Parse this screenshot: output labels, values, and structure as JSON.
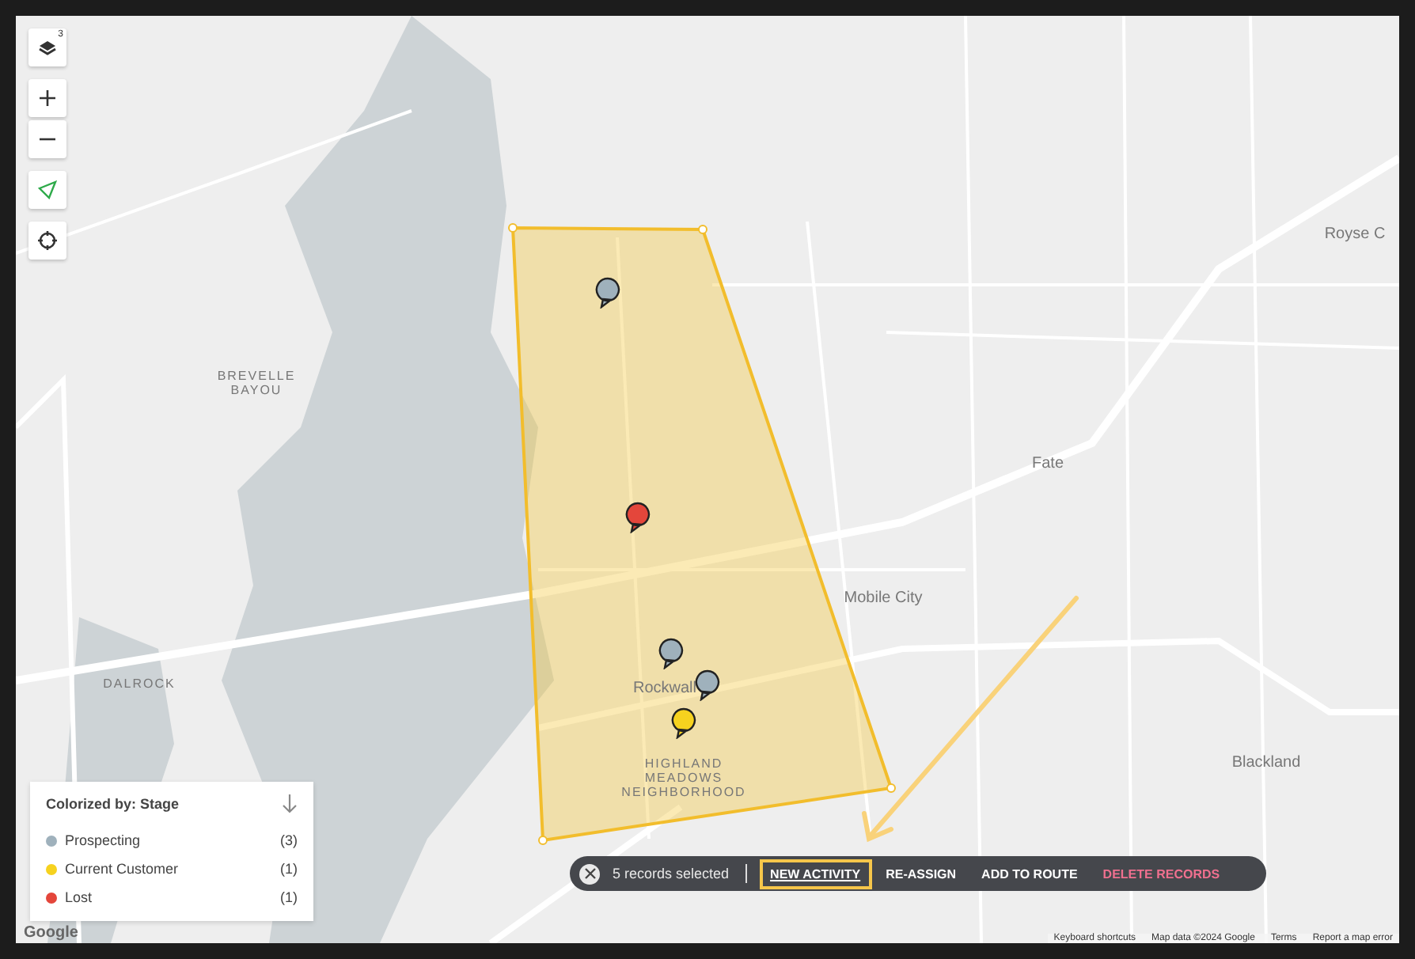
{
  "map_controls": {
    "layers_badge": "3"
  },
  "places": [
    {
      "label": "BREVELLE\nBAYOU",
      "kind": "area"
    },
    {
      "label": "DALROCK",
      "kind": "area"
    },
    {
      "label": "Mobile City",
      "kind": "city"
    },
    {
      "label": "Fate",
      "kind": "city"
    },
    {
      "label": "Blackland",
      "kind": "city"
    },
    {
      "label": "Rockwall",
      "kind": "city"
    },
    {
      "label": "HIGHLAND\nMEADOWS\nNEIGHBORHOOD",
      "kind": "area"
    },
    {
      "label": "Royse C",
      "kind": "city"
    }
  ],
  "pins": [
    {
      "color": "#9fb1bc"
    },
    {
      "color": "#e4463b"
    },
    {
      "color": "#9fb1bc"
    },
    {
      "color": "#9fb1bc"
    },
    {
      "color": "#f6d21f"
    }
  ],
  "legend": {
    "title": "Colorized by: Stage",
    "items": [
      {
        "label": "Prospecting",
        "count": "(3)",
        "color": "#9fb1bc"
      },
      {
        "label": "Current Customer",
        "count": "(1)",
        "color": "#f6d21f"
      },
      {
        "label": "Lost",
        "count": "(1)",
        "color": "#e4463b"
      }
    ]
  },
  "action_bar": {
    "selection": "5 records selected",
    "actions": [
      {
        "label": "NEW ACTIVITY",
        "highlighted": true,
        "kind": "normal"
      },
      {
        "label": "RE-ASSIGN",
        "highlighted": false,
        "kind": "normal"
      },
      {
        "label": "ADD TO ROUTE",
        "highlighted": false,
        "kind": "normal"
      },
      {
        "label": "DELETE RECORDS",
        "highlighted": false,
        "kind": "danger"
      }
    ]
  },
  "logo": "Google",
  "attribution": [
    "Keyboard shortcuts",
    "Map data ©2024 Google",
    "Terms",
    "Report a map error"
  ]
}
